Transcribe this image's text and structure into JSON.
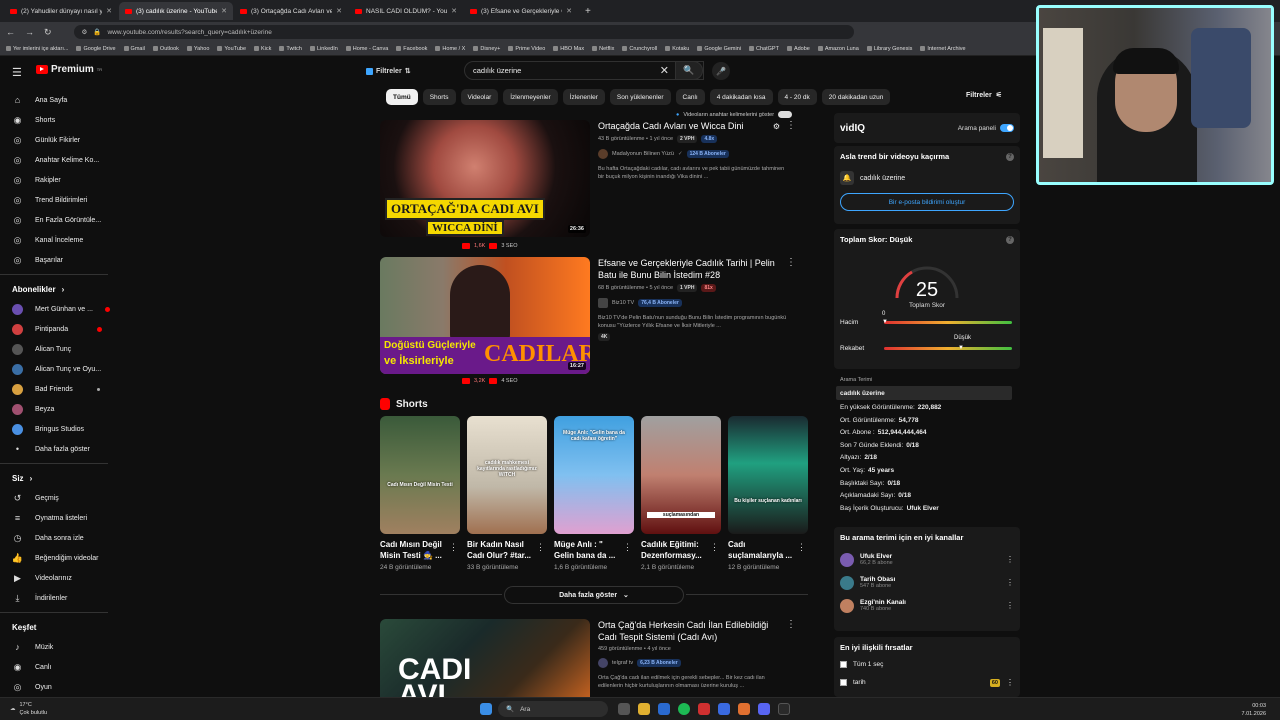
{
  "browser": {
    "tabs": [
      {
        "title": "(2) Yahudiler dünyayı nasıl yöne",
        "active": false
      },
      {
        "title": "(3) cadılık üzerine - YouTube",
        "active": true
      },
      {
        "title": "(3) Ortaçağda Cadı Avları ve",
        "active": false
      },
      {
        "title": "NASIL CADI OLDUM? - You",
        "active": false
      },
      {
        "title": "(3) Efsane ve Gerçekleriyle Cadı",
        "active": false
      }
    ],
    "url": "www.youtube.com/results?search_query=cadılık+üzerine",
    "bookmarks": [
      "Yer imlerini içe aktarı...",
      "Google Drive",
      "Gmail",
      "Outlook",
      "Yahoo",
      "YouTube",
      "Kick",
      "Twitch",
      "LinkedIn",
      "Home - Canva",
      "Facebook",
      "Home / X",
      "Disney+",
      "Prime Video",
      "HBO Max",
      "Netflix",
      "Crunchyroll",
      "Kotaku",
      "Google Gemini",
      "ChatGPT",
      "Adobe",
      "Amazon Luna",
      "Library Genesis",
      "Internet Archive"
    ]
  },
  "header": {
    "logo_text": "Premium",
    "logo_sup": "TR",
    "filters_label": "Filtreler",
    "search_value": "cadılık üzerine"
  },
  "sidebar": {
    "main": [
      {
        "label": "Ana Sayfa",
        "icon": "home-icon"
      },
      {
        "label": "Shorts",
        "icon": "shorts-icon"
      },
      {
        "label": "Günlük Fikirler",
        "icon": "bulb-icon"
      },
      {
        "label": "Anahtar Kelime Ko...",
        "icon": "key-icon"
      },
      {
        "label": "Rakipler",
        "icon": "users-icon"
      },
      {
        "label": "Trend Bildirimleri",
        "icon": "trend-icon"
      },
      {
        "label": "En Fazla Görüntüle...",
        "icon": "eye-icon"
      },
      {
        "label": "Kanal İnceleme",
        "icon": "search-icon"
      },
      {
        "label": "Başarılar",
        "icon": "trophy-icon"
      }
    ],
    "subs_header": "Abonelikler",
    "subs": [
      {
        "label": "Mert Günhan ve ...",
        "color": "#6a4fb0"
      },
      {
        "label": "Pintipanda",
        "color": "#d04040"
      },
      {
        "label": "Alican Tunç",
        "color": "#555555"
      },
      {
        "label": "Alican Tunç ve Oyu...",
        "color": "#3a6ea5"
      },
      {
        "label": "Bad Friends",
        "color": "#d8a040"
      },
      {
        "label": "Beyza",
        "color": "#a05070"
      },
      {
        "label": "Bringus Studios",
        "color": "#4a90e2"
      }
    ],
    "more_subs": "Daha fazla göster",
    "you_header": "Siz",
    "you": [
      {
        "label": "Geçmiş",
        "icon": "history-icon"
      },
      {
        "label": "Oynatma listeleri",
        "icon": "playlist-icon"
      },
      {
        "label": "Daha sonra izle",
        "icon": "clock-icon"
      },
      {
        "label": "Beğendiğim videolar",
        "icon": "like-icon"
      },
      {
        "label": "Videolarınız",
        "icon": "video-icon"
      },
      {
        "label": "İndirilenler",
        "icon": "download-icon"
      }
    ],
    "explore_header": "Keşfet",
    "explore": [
      {
        "label": "Müzik",
        "icon": "music-icon"
      },
      {
        "label": "Canlı",
        "icon": "live-icon"
      },
      {
        "label": "Oyun",
        "icon": "game-icon"
      }
    ]
  },
  "chips": [
    "Tümü",
    "Shorts",
    "Videolar",
    "İzlenmeyenler",
    "İzlenenler",
    "Son yüklenenler",
    "Canlı",
    "4 dakikadan kısa",
    "4 - 20 dk",
    "20 dakikadan uzun"
  ],
  "filters_right": "Filtreler",
  "keyword_toggle": "Videoların anahtar kelimelerini göster",
  "videos": [
    {
      "title": "Ortaçağda Cadı Avları ve Wicca Dini",
      "meta": "43 B görüntülenme • 1 yıl önce",
      "vph": "2 VPH",
      "multiplier": "4.8x",
      "channel": "Madalyonun Bilinen Yüzü",
      "subs": "124 B Aboneler",
      "desc": "Bu hafta Ortaçağdaki cadılar, cadı avlarını ve pek tabii günümüzde tahminen bir buçuk milyon kişinin inandığı Vika dinini ...",
      "duration": "26:36",
      "thumb_text1": "ORTAÇAĞ'DA CADI AVI",
      "thumb_text2": "VE",
      "thumb_text3": "WICCA DİNİ",
      "likes": "1,6K",
      "seo": "3 SEO"
    },
    {
      "title": "Efsane ve Gerçekleriyle Cadılık Tarihi | Pelin Batu ile Bunu Bilin İstedim #28",
      "meta": "68 B görüntülenme • 5 yıl önce",
      "vph": "1 VPH",
      "multiplier": "81x",
      "channel": "Biz10 TV",
      "subs": "76,4 B Aboneler",
      "desc": "Biz10 TV'de Pelin Batu'nun sunduğu Bunu Bilin İstedim programının bugünkü konusu \"Yüzlerce Yıllık Efsane ve İksir Mitleriyle ...",
      "tag": "4K",
      "duration": "16:27",
      "thumb_text1": "Doğüstü Güçleriyle",
      "thumb_text2": "ve İksirleriyle",
      "thumb_text3": "CADILAR",
      "likes": "3,2K",
      "seo": "4 SEO"
    },
    {
      "title": "Orta Çağ'da Herkesin Cadı İlan Edilebildiği Cadı Tespit Sistemi (Cadı Avı)",
      "meta": "459 görüntülenme • 4 yıl önce",
      "channel": "telgraf tv",
      "subs": "6,23 B Aboneler",
      "desc": "Orta Çağ'da cadı ilan edilmek için gerekli sebepler... Bir kez cadı ilan edilenlerin hiçbir kurtuluşlarının olmaması üzerine kuruluş ...",
      "thumb_text1": "CADI",
      "thumb_text2": "AVI"
    }
  ],
  "shorts": {
    "header": "Shorts",
    "items": [
      {
        "title": "Cadı Mısın Değil Misin Testi 🧙 ...",
        "views": "24 B görüntüleme",
        "overlay": "Cadı Mısın Değil Misin Testi"
      },
      {
        "title": "Bir Kadın Nasıl Cadı Olur? #tar...",
        "views": "33 B görüntüleme",
        "overlay": "cadılık mahkemesi kayıtlarında rastladığımız WITCH"
      },
      {
        "title": "Müge Anlı : \" Gelin bana da ...",
        "views": "1,6 B görüntüleme",
        "overlay": "Müge Anlı: \"Gelin bana da cadı kafası öğretin\""
      },
      {
        "title": "Cadılık Eğitimi: Dezenformasy...",
        "views": "2,1 B görüntüleme",
        "overlay": "suçlamasından"
      },
      {
        "title": "Cadı suçlamalarıyla ...",
        "views": "12 B görüntüleme",
        "overlay": "Bu kişiler suçlanan kadınları"
      }
    ],
    "more": "Daha fazla göster"
  },
  "vidiq": {
    "logo": "vidIQ",
    "panel_label": "Arama paneli",
    "trend_title": "Asla trend bir videoyu kaçırma",
    "trend_keyword": "cadılık üzerine",
    "email_btn": "Bir e-posta bildirimi oluştur",
    "score_title": "Toplam Skor: Düşük",
    "score": "25",
    "score_label": "Toplam Skor",
    "volume_label": "Hacim",
    "volume_value": "0",
    "competition_label": "Rekabet",
    "competition_value": "Düşük",
    "term_label": "Arama Terimi",
    "term_value": "cadılık üzerine",
    "stats": [
      {
        "k": "En yüksek Görüntülenme:",
        "v": "220,882"
      },
      {
        "k": "Ort. Görüntülenme:",
        "v": "54,778"
      },
      {
        "k": "Ort. Abone :",
        "v": "512,944,444,464"
      },
      {
        "k": "Son 7 Günde Eklendi:",
        "v": "0/18"
      },
      {
        "k": "Altyazı:",
        "v": "2/18"
      },
      {
        "k": "Ort. Yaş:",
        "v": "45 years"
      },
      {
        "k": "Başlıktaki Sayı:",
        "v": "0/18"
      },
      {
        "k": "Açıklamadaki Sayı:",
        "v": "0/18"
      },
      {
        "k": "Baş İçerik Oluşturucu:",
        "v": "Ufuk Elver"
      }
    ],
    "channels_title": "Bu arama terimi için en iyi kanallar",
    "channels": [
      {
        "name": "Ufuk Elver",
        "subs": "66,2 B abone",
        "color": "#7a5cb0"
      },
      {
        "name": "Tarih Obası",
        "subs": "547 B abone",
        "color": "#3a7a8a"
      },
      {
        "name": "Ezgi'nin Kanalı",
        "subs": "740 B abone",
        "color": "#c08060"
      }
    ],
    "opps_title": "En iyi ilişkili fırsatlar",
    "select_all": "Tüm 1 seç",
    "opp_item": "tarih",
    "opp_score": "60"
  },
  "taskbar": {
    "temp": "17°C",
    "weather": "Çok bulutlu",
    "search": "Ara",
    "time": "00:03",
    "date": "7.01.2026"
  }
}
